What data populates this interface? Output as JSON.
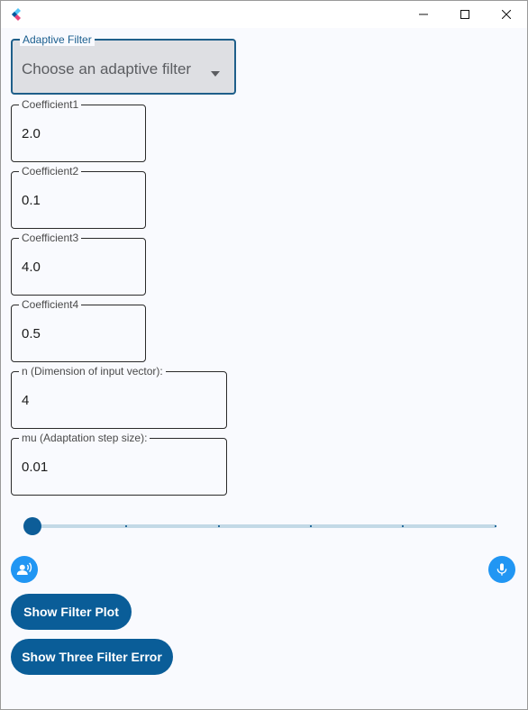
{
  "window": {
    "controls": {
      "minimize": "minimize",
      "maximize": "maximize",
      "close": "close"
    }
  },
  "adaptive_filter": {
    "label": "Adaptive Filter",
    "placeholder": "Choose an adaptive filter"
  },
  "fields": [
    {
      "label": "Coefficient1",
      "value": "2.0"
    },
    {
      "label": "Coefficient2",
      "value": "0.1"
    },
    {
      "label": "Coefficient3",
      "value": "4.0"
    },
    {
      "label": "Coefficient4",
      "value": "0.5"
    },
    {
      "label": "n (Dimension of input vector):",
      "value": "4"
    },
    {
      "label": "mu (Adaptation step size):",
      "value": "0.01"
    }
  ],
  "slider": {
    "value_fraction": 0.0,
    "divisions": 5
  },
  "icons": {
    "speaker": "record-voice-icon",
    "mic": "microphone-icon"
  },
  "buttons": {
    "show_filter_plot": "Show Filter Plot",
    "show_three_filter_error": "Show Three Filter Error"
  },
  "colors": {
    "accent": "#0a5d98",
    "icon_button": "#2196f3",
    "dropdown_fill": "#dedfe3",
    "slider_track": "#c3d9e6"
  }
}
